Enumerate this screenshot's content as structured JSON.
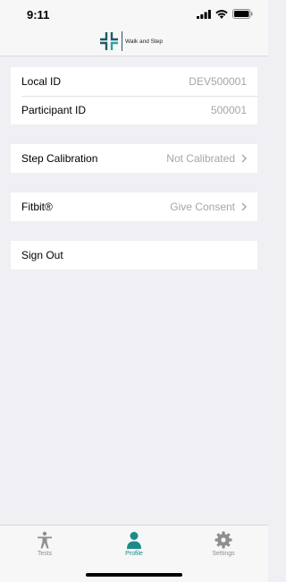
{
  "status_bar": {
    "time": "9:11"
  },
  "header": {
    "logo_text": "Walk and Step"
  },
  "ids": [
    {
      "label": "Local ID",
      "value": "DEV500001"
    },
    {
      "label": "Participant ID",
      "value": "500001"
    }
  ],
  "step_calibration": {
    "label": "Step Calibration",
    "value": "Not Calibrated"
  },
  "fitbit": {
    "label": "Fitbit®",
    "value": "Give Consent"
  },
  "sign_out": {
    "label": "Sign Out"
  },
  "tabs": [
    {
      "label": "Tests",
      "icon": "person-figure-icon"
    },
    {
      "label": "Profile",
      "icon": "person-silhouette-icon",
      "active": true
    },
    {
      "label": "Settings",
      "icon": "gear-icon"
    }
  ],
  "colors": {
    "accent": "#1d8a8a",
    "logo": "#1f5a66",
    "background": "#efeff4"
  }
}
